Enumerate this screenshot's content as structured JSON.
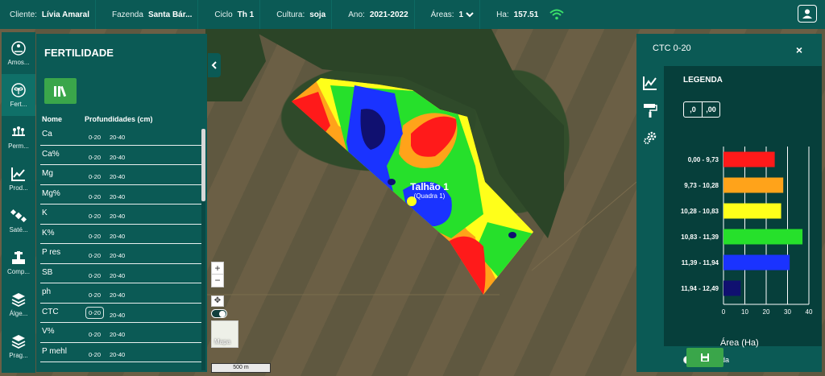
{
  "topbar": {
    "cliente_label": "Cliente:",
    "cliente": "Lívia Amaral",
    "fazenda_label": "Fazenda",
    "fazenda": "Santa Bár...",
    "ciclo_label": "Ciclo",
    "ciclo": "Th 1",
    "cultura_label": "Cultura:",
    "cultura": "soja",
    "ano_label": "Ano:",
    "ano": "2021-2022",
    "areas_label": "Áreas:",
    "areas": "1",
    "ha_label": "Ha:",
    "ha": "157.51"
  },
  "rail": [
    {
      "label": "Amos...",
      "icon": "soil-sample-icon"
    },
    {
      "label": "Fert...",
      "icon": "fertility-icon"
    },
    {
      "label": "Perm...",
      "icon": "plants-icon"
    },
    {
      "label": "Prod...",
      "icon": "productivity-icon"
    },
    {
      "label": "Saté...",
      "icon": "satellite-icon"
    },
    {
      "label": "Comp...",
      "icon": "compaction-icon"
    },
    {
      "label": "Álge...",
      "icon": "layers-icon"
    },
    {
      "label": "Prag...",
      "icon": "pests-icon"
    }
  ],
  "fertilidade": {
    "title": "FERTILIDADE",
    "col_nome": "Nome",
    "col_prof": "Profundidades (cm)",
    "rows": [
      {
        "name": "Ca",
        "d1": "0-20",
        "d2": "20-40"
      },
      {
        "name": "Ca%",
        "d1": "0-20",
        "d2": "20-40"
      },
      {
        "name": "Mg",
        "d1": "0-20",
        "d2": "20-40"
      },
      {
        "name": "Mg%",
        "d1": "0-20",
        "d2": "20-40"
      },
      {
        "name": "K",
        "d1": "0-20",
        "d2": "20-40"
      },
      {
        "name": "K%",
        "d1": "0-20",
        "d2": "20-40"
      },
      {
        "name": "P res",
        "d1": "0-20",
        "d2": "20-40"
      },
      {
        "name": "SB",
        "d1": "0-20",
        "d2": "20-40"
      },
      {
        "name": "ph",
        "d1": "0-20",
        "d2": "20-40"
      },
      {
        "name": "CTC",
        "d1": "0-20",
        "d2": "20-40",
        "selected": true
      },
      {
        "name": "V%",
        "d1": "0-20",
        "d2": "20-40"
      },
      {
        "name": "P mehl",
        "d1": "0-20",
        "d2": "20-40"
      }
    ]
  },
  "map": {
    "talhao_label": "Talhão 1",
    "talhao_sub": "(Quadra 1)",
    "zoom_in": "+",
    "zoom_out": "−",
    "mapa_label": "Mapa",
    "scale_label": "500 m"
  },
  "legend_panel": {
    "title": "CTC 0-20",
    "close": "×",
    "legend_title": "LEGENDA",
    "dec_less": ",0",
    "dec_more": ",00",
    "axis_label": "Área (Ha)",
    "legend_toggle": "Legenda"
  },
  "chart_data": {
    "type": "bar",
    "orientation": "horizontal",
    "categories": [
      "0,00 - 9,73",
      "9,73 - 10,28",
      "10,28 - 10,83",
      "10,83 - 11,39",
      "11,39 - 11,94",
      "11,94 - 12,49"
    ],
    "values": [
      24,
      28,
      27,
      37,
      31,
      8
    ],
    "colors": [
      "#ff1a1a",
      "#ffa31a",
      "#ffff1a",
      "#26e02b",
      "#1a33ff",
      "#101070"
    ],
    "xlabel": "Área (Ha)",
    "xlim": [
      0,
      40
    ],
    "xticks": [
      0,
      10,
      20,
      30,
      40
    ],
    "grid": true
  }
}
